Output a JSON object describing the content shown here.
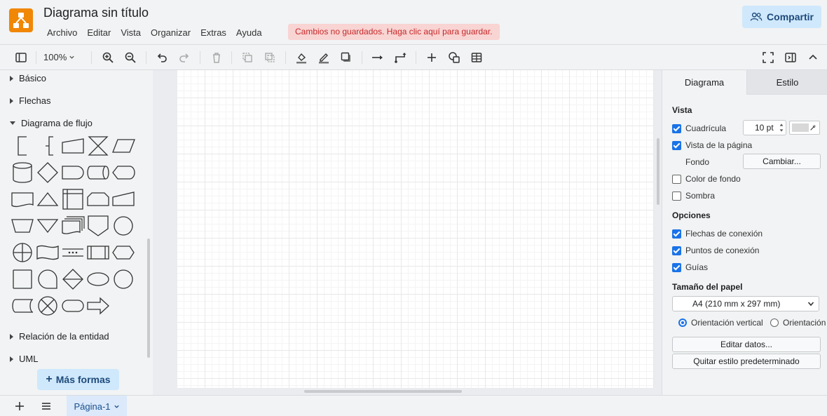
{
  "header": {
    "title": "Diagrama sin título",
    "menus": [
      "Archivo",
      "Editar",
      "Vista",
      "Organizar",
      "Extras",
      "Ayuda"
    ],
    "unsaved_notice": "Cambios no guardados. Haga clic aquí para guardar.",
    "share_label": "Compartir",
    "logo_color": "#f08705"
  },
  "toolbar": {
    "zoom": "100%"
  },
  "sidebar": {
    "categories": {
      "basic": "Básico",
      "arrows": "Flechas",
      "flowchart": "Diagrama de flujo",
      "entity": "Relación de la entidad",
      "uml": "UML"
    },
    "more_shapes": "Más formas"
  },
  "panel": {
    "tabs": {
      "diagram": "Diagrama",
      "style": "Estilo"
    },
    "view": {
      "title": "Vista",
      "grid": "Cuadrícula",
      "grid_size": "10 pt",
      "page_view": "Vista de la página",
      "background": "Fondo",
      "change": "Cambiar...",
      "bg_color": "Color de fondo",
      "shadow": "Sombra"
    },
    "options": {
      "title": "Opciones",
      "connection_arrows": "Flechas de conexión",
      "connection_points": "Puntos de conexión",
      "guides": "Guías"
    },
    "paper": {
      "title": "Tamaño del papel",
      "size": "A4 (210 mm x 297 mm)",
      "portrait": "Orientación vertical",
      "landscape": "Orientación horizontal"
    },
    "edit_data": "Editar datos...",
    "clear_style": "Quitar estilo predeterminado"
  },
  "bottom": {
    "page_tab": "Página-1"
  },
  "colors": {
    "accent": "#1a73e8",
    "button_bg": "#cfe8fc",
    "unsaved_bg": "#f8d4d3"
  }
}
